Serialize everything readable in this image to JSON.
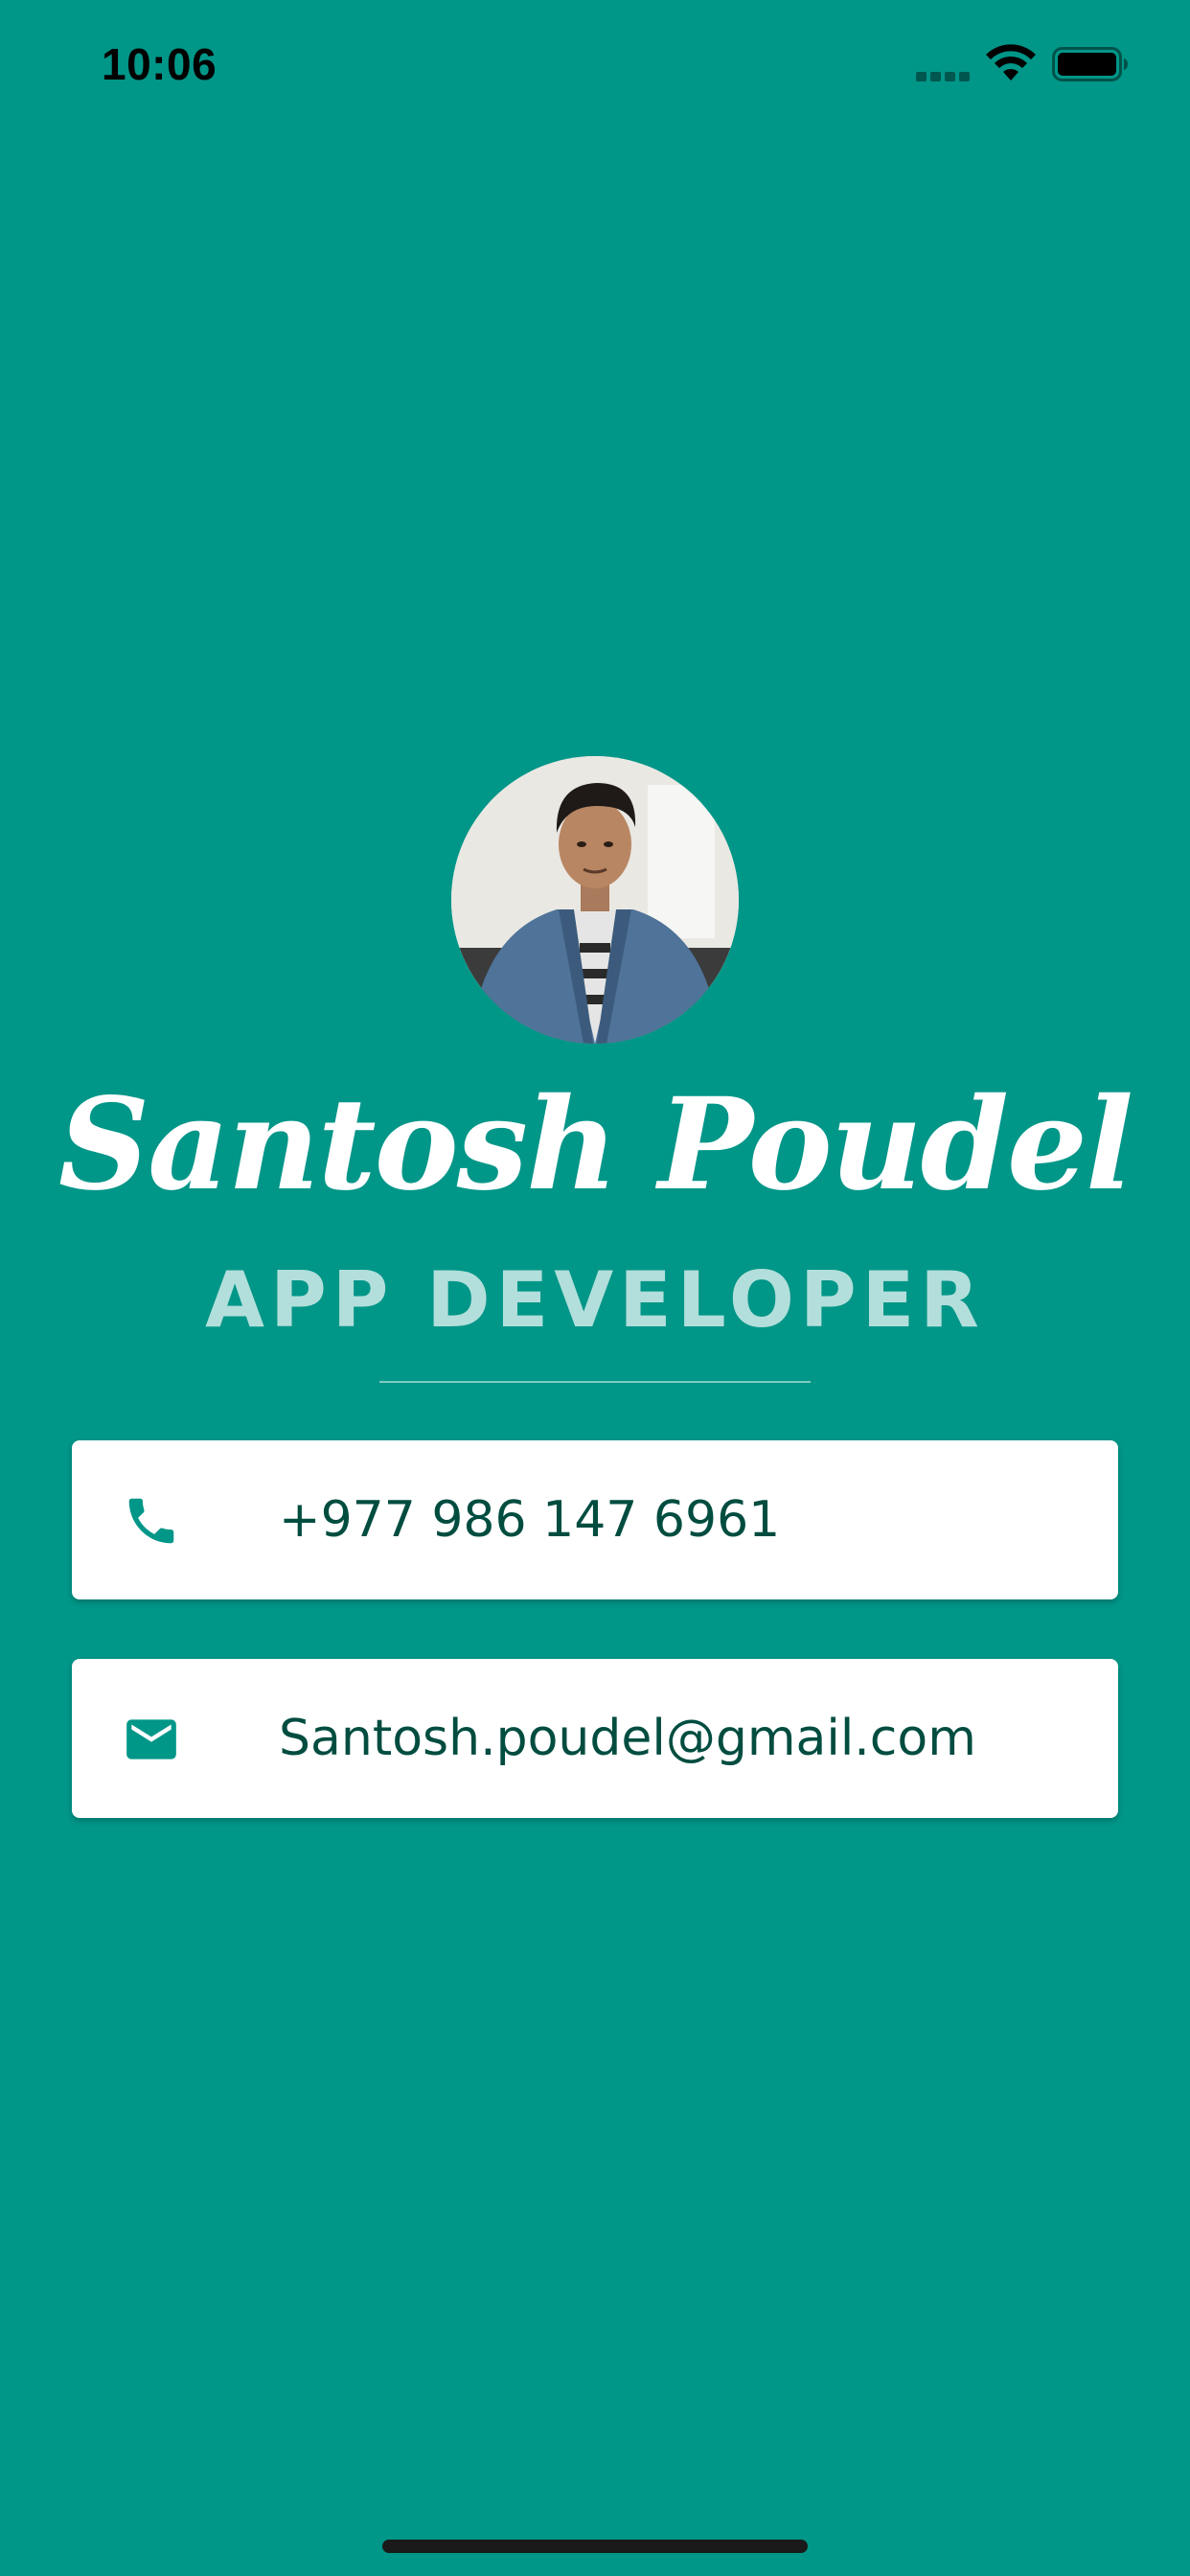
{
  "status_bar": {
    "time": "10:06"
  },
  "profile": {
    "name": "Santosh Poudel",
    "title": "APP DEVELOPER",
    "avatar_icon": "user-photo"
  },
  "contacts": [
    {
      "icon": "phone-icon",
      "value": "+977 986 147 6961"
    },
    {
      "icon": "mail-icon",
      "value": "Santosh.poudel@gmail.com"
    }
  ],
  "colors": {
    "background": "#009688",
    "accent": "#009688",
    "title": "#b2dfdb",
    "card_text": "#004d40",
    "card_background": "#ffffff"
  }
}
